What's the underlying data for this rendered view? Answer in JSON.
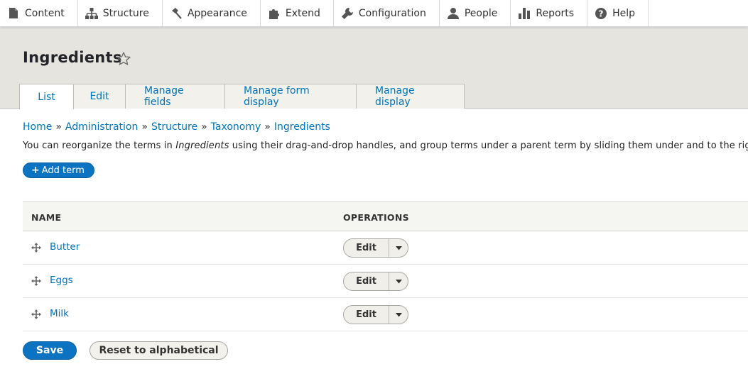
{
  "toolbar": {
    "items": [
      {
        "label": "Content",
        "icon": "content-icon"
      },
      {
        "label": "Structure",
        "icon": "structure-icon"
      },
      {
        "label": "Appearance",
        "icon": "appearance-icon"
      },
      {
        "label": "Extend",
        "icon": "extend-icon"
      },
      {
        "label": "Configuration",
        "icon": "configuration-icon"
      },
      {
        "label": "People",
        "icon": "people-icon"
      },
      {
        "label": "Reports",
        "icon": "reports-icon"
      },
      {
        "label": "Help",
        "icon": "help-icon"
      }
    ]
  },
  "header": {
    "title": "Ingredients",
    "star_icon": "star-icon",
    "tabs": [
      {
        "label": "List",
        "active": true
      },
      {
        "label": "Edit"
      },
      {
        "label": "Manage fields"
      },
      {
        "label": "Manage form display"
      },
      {
        "label": "Manage display"
      }
    ]
  },
  "breadcrumb": {
    "items": [
      "Home",
      "Administration",
      "Structure",
      "Taxonomy",
      "Ingredients"
    ],
    "separator": "»"
  },
  "help": {
    "prefix": "You can reorganize the terms in ",
    "vocabulary": "Ingredients",
    "suffix": " using their drag-and-drop handles, and group terms under a parent term by sliding them under and to the right of t"
  },
  "actions": {
    "add_term_plus": "+",
    "add_term_label": "Add term"
  },
  "table": {
    "headers": {
      "name": "NAME",
      "operations": "OPERATIONS"
    },
    "rows": [
      {
        "name": "Butter",
        "operation": "Edit"
      },
      {
        "name": "Eggs",
        "operation": "Edit"
      },
      {
        "name": "Milk",
        "operation": "Edit"
      }
    ]
  },
  "form": {
    "save_label": "Save",
    "reset_label": "Reset to alphabetical"
  },
  "colors": {
    "link": "#0074bd",
    "primary_button": "#0b73c2",
    "header_bg": "#e6e4df"
  }
}
